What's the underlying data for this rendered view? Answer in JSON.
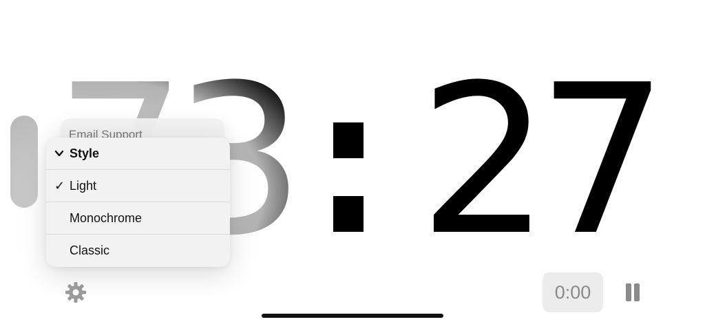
{
  "clock": {
    "hour_1": "7",
    "hour_2": "3",
    "minute_1": "2",
    "minute_2": "7"
  },
  "background_menu": {
    "item": "Email Support"
  },
  "style_menu": {
    "header_mark": "⌄",
    "header_label": "Style",
    "items": [
      {
        "label": "Light",
        "checked": true,
        "mark": "✓"
      },
      {
        "label": "Monochrome",
        "checked": false,
        "mark": ""
      },
      {
        "label": "Classic",
        "checked": false,
        "mark": ""
      }
    ]
  },
  "stopwatch": {
    "time": "0:00"
  },
  "icons": {
    "settings": "gear-icon",
    "pause": "pause-icon",
    "chevron": "chevron-down-icon",
    "check": "checkmark-icon"
  },
  "colors": {
    "digits": "#000000",
    "menu_bg": "#f2f2f2",
    "stopwatch_bg": "#ececec",
    "secondary": "#8a8a8a"
  }
}
